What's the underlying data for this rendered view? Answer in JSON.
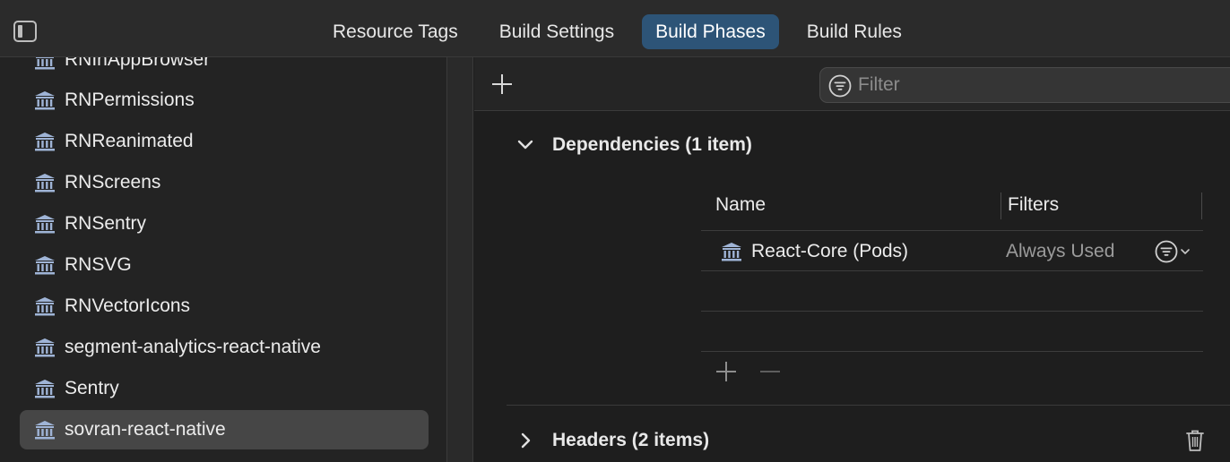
{
  "tabs": [
    {
      "label": "Resource Tags",
      "active": false
    },
    {
      "label": "Build Settings",
      "active": false
    },
    {
      "label": "Build Phases",
      "active": true
    },
    {
      "label": "Build Rules",
      "active": false
    }
  ],
  "sidebar": {
    "items": [
      {
        "label": "RNInAppBrowser",
        "selected": false
      },
      {
        "label": "RNPermissions",
        "selected": false
      },
      {
        "label": "RNReanimated",
        "selected": false
      },
      {
        "label": "RNScreens",
        "selected": false
      },
      {
        "label": "RNSentry",
        "selected": false
      },
      {
        "label": "RNSVG",
        "selected": false
      },
      {
        "label": "RNVectorIcons",
        "selected": false
      },
      {
        "label": "segment-analytics-react-native",
        "selected": false
      },
      {
        "label": "Sentry",
        "selected": false
      },
      {
        "label": "sovran-react-native",
        "selected": true
      }
    ],
    "item_icon": "library-columns-icon"
  },
  "toolbar": {
    "add_icon": "plus-icon",
    "filter_placeholder": "Filter",
    "filter_icon": "filter-circle-icon"
  },
  "dependencies": {
    "title": "Dependencies (1 item)",
    "expanded": true,
    "columns": {
      "name": "Name",
      "filters": "Filters"
    },
    "rows": [
      {
        "name": "React-Core (Pods)",
        "filter": "Always Used"
      }
    ]
  },
  "headers_section": {
    "title": "Headers (2 items)",
    "expanded": false
  },
  "colors": {
    "accent_tab": "#2d5477",
    "selected_row": "#464646",
    "background": "#1e1e1e"
  }
}
